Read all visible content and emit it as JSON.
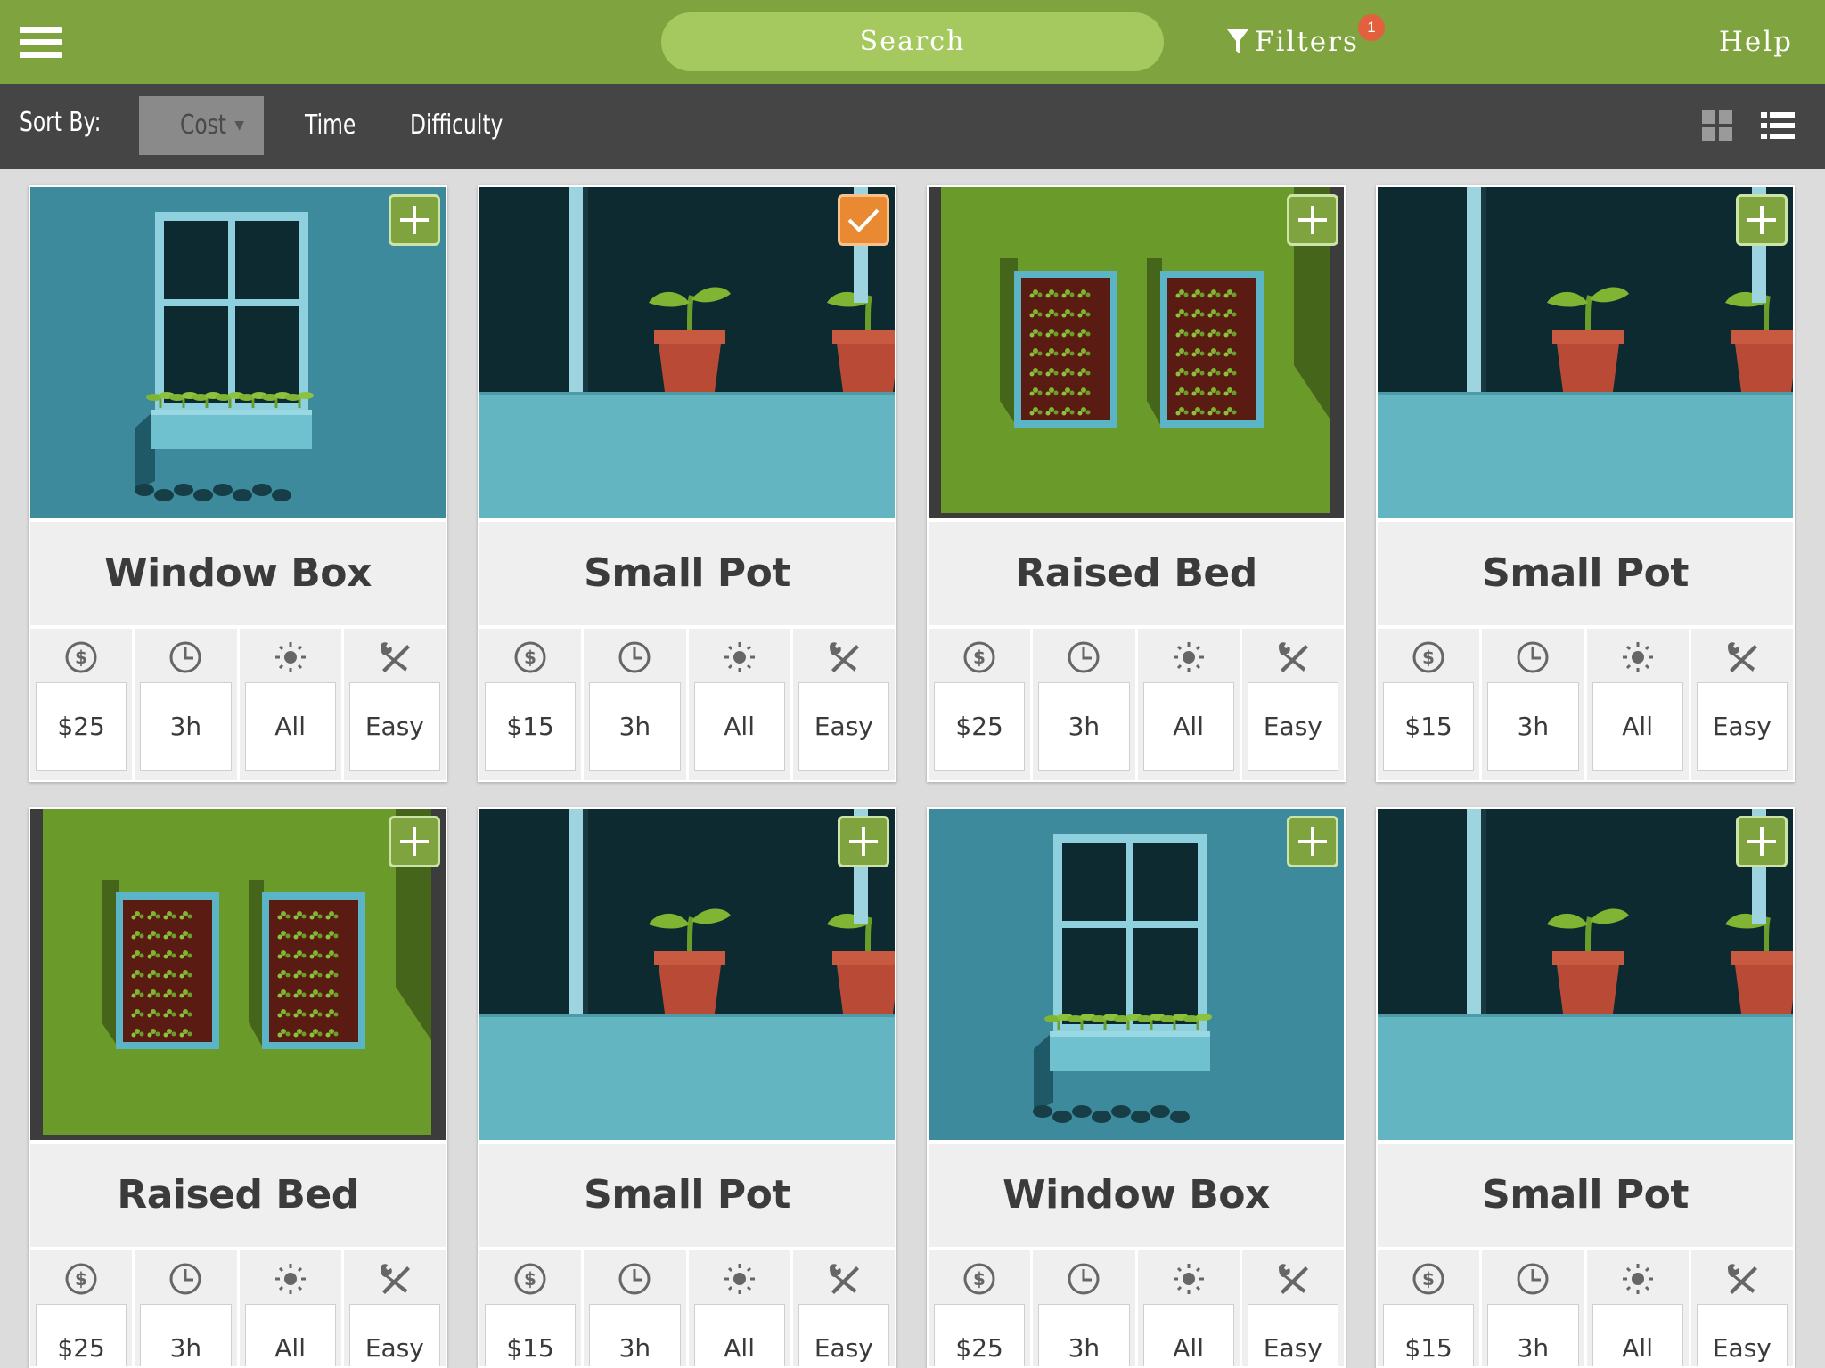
{
  "topbar": {
    "search_placeholder": "Search",
    "filters_label": "Filters",
    "filters_count": "1",
    "help_label": "Help",
    "color": "#7ea33f"
  },
  "sortbar": {
    "label": "Sort By:",
    "options": [
      "Cost",
      "Time",
      "Difficulty"
    ],
    "active": "Cost"
  },
  "cards": [
    {
      "title": "Window Box",
      "image": "window-box",
      "cost": "$25",
      "time": "3h",
      "sun": "All",
      "difficulty": "Easy",
      "added": false
    },
    {
      "title": "Small Pot",
      "image": "small-pot",
      "cost": "$15",
      "time": "3h",
      "sun": "All",
      "difficulty": "Easy",
      "added": true
    },
    {
      "title": "Raised Bed",
      "image": "raised-bed",
      "cost": "$25",
      "time": "3h",
      "sun": "All",
      "difficulty": "Easy",
      "added": false
    },
    {
      "title": "Small Pot",
      "image": "small-pot",
      "cost": "$15",
      "time": "3h",
      "sun": "All",
      "difficulty": "Easy",
      "added": false
    },
    {
      "title": "Raised Bed",
      "image": "raised-bed",
      "cost": "$25",
      "time": "3h",
      "sun": "All",
      "difficulty": "Easy",
      "added": false
    },
    {
      "title": "Small Pot",
      "image": "small-pot",
      "cost": "$15",
      "time": "3h",
      "sun": "All",
      "difficulty": "Easy",
      "added": false
    },
    {
      "title": "Window Box",
      "image": "window-box",
      "cost": "$25",
      "time": "3h",
      "sun": "All",
      "difficulty": "Easy",
      "added": false
    },
    {
      "title": "Small Pot",
      "image": "small-pot",
      "cost": "$15",
      "time": "3h",
      "sun": "All",
      "difficulty": "Easy",
      "added": false
    }
  ],
  "icons": {
    "cost": "dollar-icon",
    "time": "clock-icon",
    "sun": "sun-icon",
    "difficulty": "tools-icon"
  }
}
